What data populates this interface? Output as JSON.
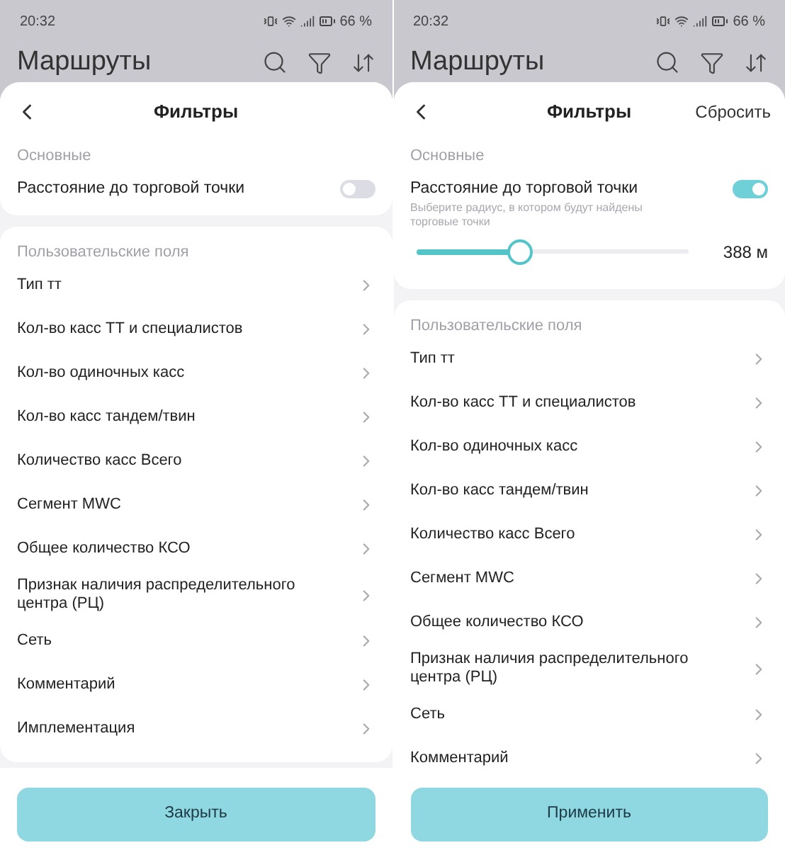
{
  "screens": [
    {
      "status_bar": {
        "time": "20:32",
        "battery": "66 %"
      },
      "app_title": "Маршруты",
      "sheet": {
        "title": "Фильтры",
        "basic": {
          "label": "Основные",
          "toggle_label": "Расстояние до торговой точки",
          "on": false
        },
        "custom": {
          "label": "Пользовательские поля",
          "items": [
            "Тип тт",
            "Кол-во касс ТТ и специалистов",
            "Кол-во одиночных касс",
            "Кол-во касс тандем/твин",
            "Количество касс Всего",
            "Сегмент MWC",
            "Общее количество КСО",
            "Признак наличия распределительного центра (РЦ)",
            "Сеть",
            "Комментарий",
            "Имплементация"
          ]
        },
        "button": "Закрыть"
      }
    },
    {
      "status_bar": {
        "time": "20:32",
        "battery": "66 %"
      },
      "app_title": "Маршруты",
      "sheet": {
        "title": "Фильтры",
        "reset": "Сбросить",
        "basic": {
          "label": "Основные",
          "toggle_label": "Расстояние до торговой точки",
          "on": true,
          "hint": "Выберите радиус, в котором будут найдены торговые точки",
          "slider": {
            "level": 0.385,
            "reading": "388 м"
          }
        },
        "custom": {
          "label": "Пользовательские поля",
          "items": [
            "Тип тт",
            "Кол-во касс ТТ и специалистов",
            "Кол-во одиночных касс",
            "Кол-во касс тандем/твин",
            "Количество касс Всего",
            "Сегмент MWC",
            "Общее количество КСО",
            "Признак наличия распределительного центра (РЦ)",
            "Сеть",
            "Комментарий"
          ]
        },
        "button": "Применить"
      }
    }
  ]
}
